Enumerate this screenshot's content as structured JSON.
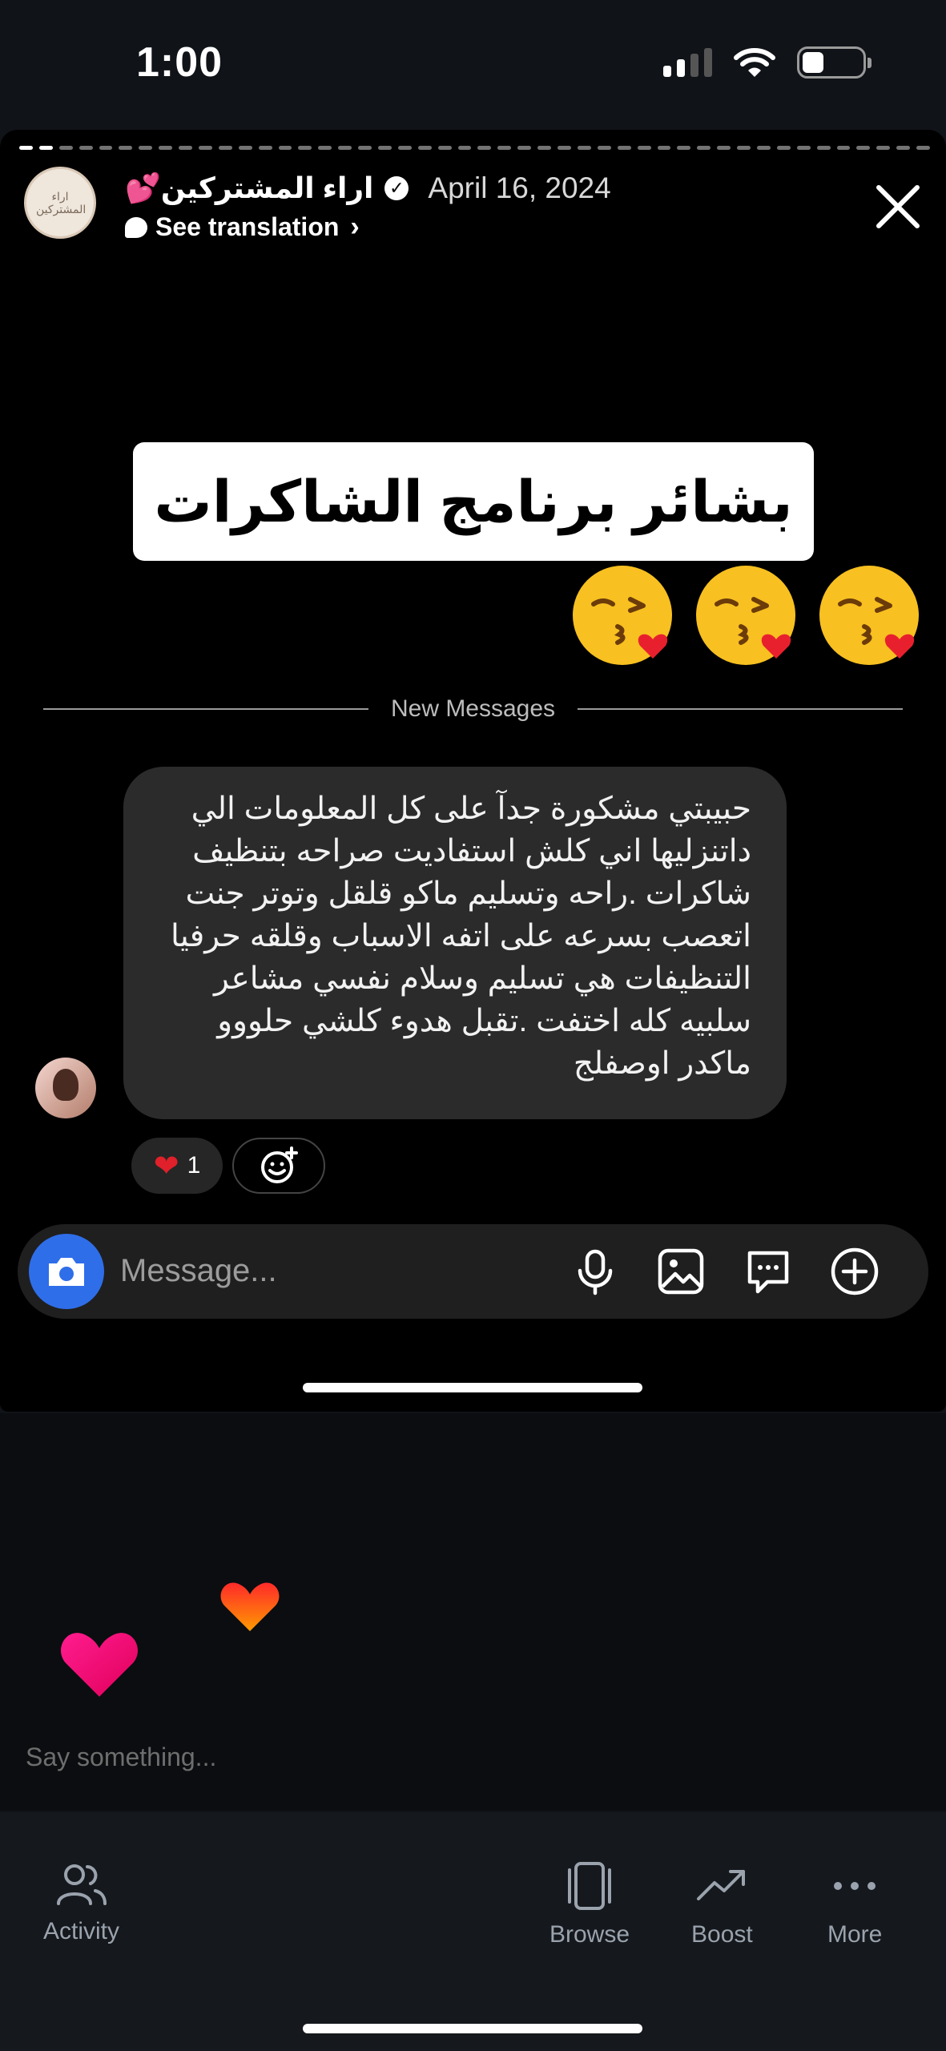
{
  "status_bar": {
    "time": "1:00"
  },
  "story": {
    "account_name": "اراء المشتركين💕",
    "date": "April 16, 2024",
    "see_translation": "See translation",
    "avatar_text": "اراء المشتركين",
    "headline": "بشائر برنامج الشاكرات",
    "emojis": [
      "kissing-face-with-heart",
      "kissing-face-with-heart",
      "kissing-face-with-heart"
    ]
  },
  "chat": {
    "divider_label": "New Messages",
    "message_lines": [
      "حبيبتي مشكورة جدآ على كل المعلومات الي",
      "داتنزليها اني كلش استفاديت صراحه بتنظيف",
      "شاكرات .راحه وتسليم ماكو قلقل وتوتر جنت",
      "اتعصب بسرعه على اتفه الاسباب وقلقه حرفيا",
      "التنظيفات هي تسليم وسلام نفسي مشاعر",
      "سلبيه كله اختفت .تقبل هدوء كلشي حلووو",
      "ماكدر اوصفلج"
    ],
    "reaction_emoji": "❤",
    "reaction_count": "1"
  },
  "composer": {
    "placeholder": "Message..."
  },
  "comment": {
    "placeholder": "Say something..."
  },
  "tabs": [
    {
      "label": "Activity",
      "icon": "people-icon"
    },
    {
      "label": "Browse",
      "icon": "browse-icon"
    },
    {
      "label": "Boost",
      "icon": "trending-icon"
    },
    {
      "label": "More",
      "icon": "more-dots-icon"
    }
  ],
  "colors": {
    "camera_button": "#2f6ee9",
    "bubble": "#2b2b2b",
    "heart_red": "#e0202a"
  }
}
